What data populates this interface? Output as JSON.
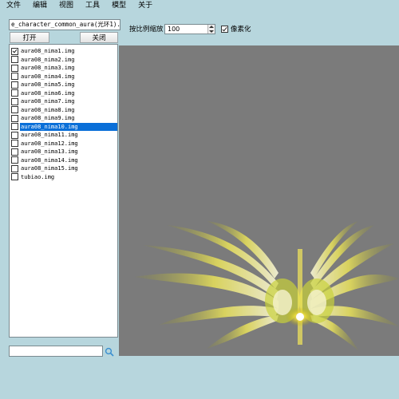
{
  "menu": [
    "文件",
    "编辑",
    "视图",
    "工具",
    "模型",
    "关于"
  ],
  "file_path": "e_character_common_aura(光环1).NPK",
  "open_button": "打开",
  "close_button": "关闭",
  "files": [
    {
      "name": "aura08_nima1.img",
      "checked": true,
      "selected": false
    },
    {
      "name": "aura08_nima2.img",
      "checked": false,
      "selected": false
    },
    {
      "name": "aura08_nima3.img",
      "checked": false,
      "selected": false
    },
    {
      "name": "aura08_nima4.img",
      "checked": false,
      "selected": false
    },
    {
      "name": "aura08_nima5.img",
      "checked": false,
      "selected": false
    },
    {
      "name": "aura08_nima6.img",
      "checked": false,
      "selected": false
    },
    {
      "name": "aura08_nima7.img",
      "checked": false,
      "selected": false
    },
    {
      "name": "aura08_nima8.img",
      "checked": false,
      "selected": false
    },
    {
      "name": "aura08_nima9.img",
      "checked": false,
      "selected": false
    },
    {
      "name": "aura08_nima10.img",
      "checked": false,
      "selected": true
    },
    {
      "name": "aura08_nima11.img",
      "checked": false,
      "selected": false
    },
    {
      "name": "aura08_nima12.img",
      "checked": false,
      "selected": false
    },
    {
      "name": "aura08_nima13.img",
      "checked": false,
      "selected": false
    },
    {
      "name": "aura08_nima14.img",
      "checked": false,
      "selected": false
    },
    {
      "name": "aura08_nima15.img",
      "checked": false,
      "selected": false
    },
    {
      "name": "tubiao.img",
      "checked": false,
      "selected": false
    }
  ],
  "search": {
    "value": "",
    "icon": "search-icon"
  },
  "zoom": {
    "label": "按比例缩放",
    "value": "100"
  },
  "pixelate": {
    "label": "像素化",
    "checked": true
  },
  "colors": {
    "background": "#b7d6dd",
    "selection": "#0a6fd8",
    "preview_bg": "#7b7b7b"
  }
}
